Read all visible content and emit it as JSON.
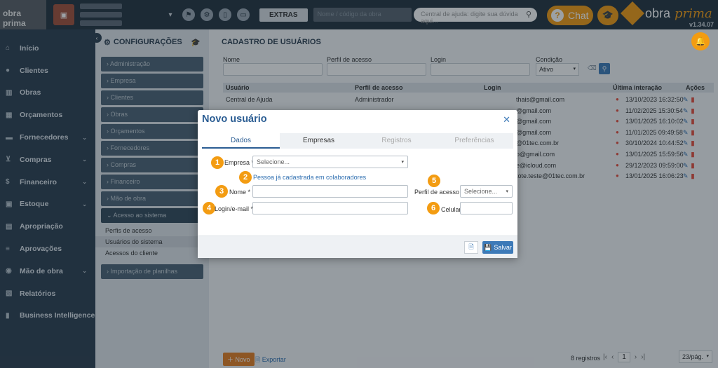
{
  "topbar": {
    "brand": "obra prima",
    "extras_label": "EXTRAS",
    "company_placeholder": "Nome / código da obra",
    "help_placeholder": "Central de ajuda: digite sua dúvida aqui...",
    "chat_label": "Chat",
    "logo_text": "obra",
    "logo_italic": "prima",
    "version": "v1.34.07"
  },
  "sidebar": {
    "items": [
      {
        "label": "Início",
        "icon": "home-icon"
      },
      {
        "label": "Clientes",
        "icon": "user-icon"
      },
      {
        "label": "Obras",
        "icon": "building-icon"
      },
      {
        "label": "Orçamentos",
        "icon": "calculator-icon"
      },
      {
        "label": "Fornecedores",
        "icon": "truck-icon",
        "chevron": true
      },
      {
        "label": "Compras",
        "icon": "cart-icon",
        "chevron": true
      },
      {
        "label": "Financeiro",
        "icon": "dollar-icon",
        "chevron": true
      },
      {
        "label": "Estoque",
        "icon": "box-icon",
        "chevron": true
      },
      {
        "label": "Apropriação",
        "icon": "file-icon"
      },
      {
        "label": "Aprovações",
        "icon": "check-list-icon"
      },
      {
        "label": "Mão de obra",
        "icon": "workers-icon",
        "chevron": true
      },
      {
        "label": "Relatórios",
        "icon": "report-icon"
      },
      {
        "label": "Business Intelligence",
        "icon": "chart-icon"
      }
    ]
  },
  "config": {
    "title": "CONFIGURAÇÕES",
    "items": [
      "Administração",
      "Empresa",
      "Clientes",
      "Obras",
      "Orçamentos",
      "Fornecedores",
      "Compras",
      "Financeiro",
      "Mão de obra"
    ],
    "active_item": "Acesso ao sistema",
    "sub_items": [
      "Perfis de acesso",
      "Usuários do sistema",
      "Acessos do cliente"
    ],
    "bottom_item": "Importação de planilhas"
  },
  "main": {
    "title": "CADASTRO DE USUÁRIOS",
    "filters": {
      "nome": "Nome",
      "perfil": "Perfil de acesso",
      "login": "Login",
      "condicao": "Condição",
      "condicao_value": "Ativo"
    },
    "columns": [
      "Usuário",
      "Perfil de acesso",
      "Login",
      "Última interação",
      "Ações"
    ],
    "rows": [
      {
        "usuario": "Central de Ajuda",
        "perfil": "Administrador",
        "login": "thais@gmail.com",
        "data": "13/10/2023 16:32:50"
      },
      {
        "usuario": "",
        "perfil": "",
        "login": "@gmail.com",
        "data": "11/02/2025 15:30:54"
      },
      {
        "usuario": "",
        "perfil": "",
        "login": "@gmail.com",
        "data": "13/01/2025 16:10:02"
      },
      {
        "usuario": "",
        "perfil": "",
        "login": "@gmail.com",
        "data": "11/01/2025 09:49:58"
      },
      {
        "usuario": "",
        "perfil": "",
        "login": "@01tec.com.br",
        "data": "30/10/2024 10:44:52"
      },
      {
        "usuario": "",
        "perfil": "",
        "login": "o@gmail.com",
        "data": "13/01/2025 15:59:56"
      },
      {
        "usuario": "",
        "perfil": "",
        "login": "e@icloud.com",
        "data": "29/12/2023 09:59:00"
      },
      {
        "usuario": "",
        "perfil": "",
        "login": "tote.teste@01tec.com.br",
        "data": "13/01/2025 16:06:23"
      }
    ],
    "new_label": "Novo",
    "export_label": "Exportar",
    "count_text": "8 registros",
    "page": "1",
    "per_page": "23/pág."
  },
  "modal": {
    "title": "Novo usuário",
    "tabs": [
      "Dados",
      "Empresas",
      "Registros",
      "Preferências"
    ],
    "fields": {
      "empresa_label": "Empresa *",
      "empresa_placeholder": "Selecione...",
      "link_text": "Pessoa já cadastrada em colaboradores",
      "nome_label": "Nome *",
      "login_label": "Login/e-mail *",
      "perfil_label": "Perfil de acesso *",
      "perfil_placeholder": "Selecione...",
      "celular_label": "Celular"
    },
    "badges": [
      "1",
      "2",
      "3",
      "4",
      "5",
      "6"
    ],
    "save_label": "Salvar"
  },
  "colors": {
    "accent": "#f39c12",
    "primary": "#2b5d93",
    "sidebar": "#2c3e50"
  }
}
